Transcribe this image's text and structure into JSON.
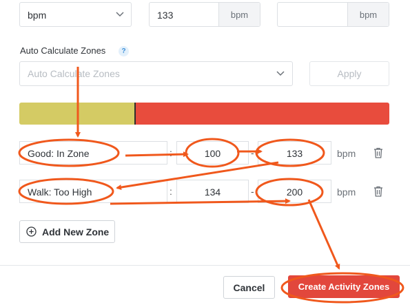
{
  "top_row": {
    "unit_select_value": "bpm",
    "value_input": "133",
    "value_unit": "bpm",
    "empty_input": "",
    "empty_unit": "bpm"
  },
  "auto_calc": {
    "label": "Auto Calculate Zones",
    "help": "?",
    "select_placeholder": "Auto Calculate Zones",
    "apply_label": "Apply"
  },
  "zone_bar": {
    "segments": [
      {
        "color": "#d4cb64",
        "fraction": 0.3142
      },
      {
        "color": "#e84c3d",
        "fraction": 0.6858
      }
    ]
  },
  "zones": [
    {
      "name": "Good: In Zone",
      "colon": ":",
      "from": "100",
      "dash": "-",
      "to": "133",
      "unit": "bpm"
    },
    {
      "name": "Walk: Too High",
      "colon": ":",
      "from": "134",
      "dash": "-",
      "to": "200",
      "unit": "bpm"
    }
  ],
  "add_zone_label": "Add New Zone",
  "footer": {
    "cancel_label": "Cancel",
    "create_label": "Create Activity Zones"
  },
  "annotation_color": "#f0581c"
}
